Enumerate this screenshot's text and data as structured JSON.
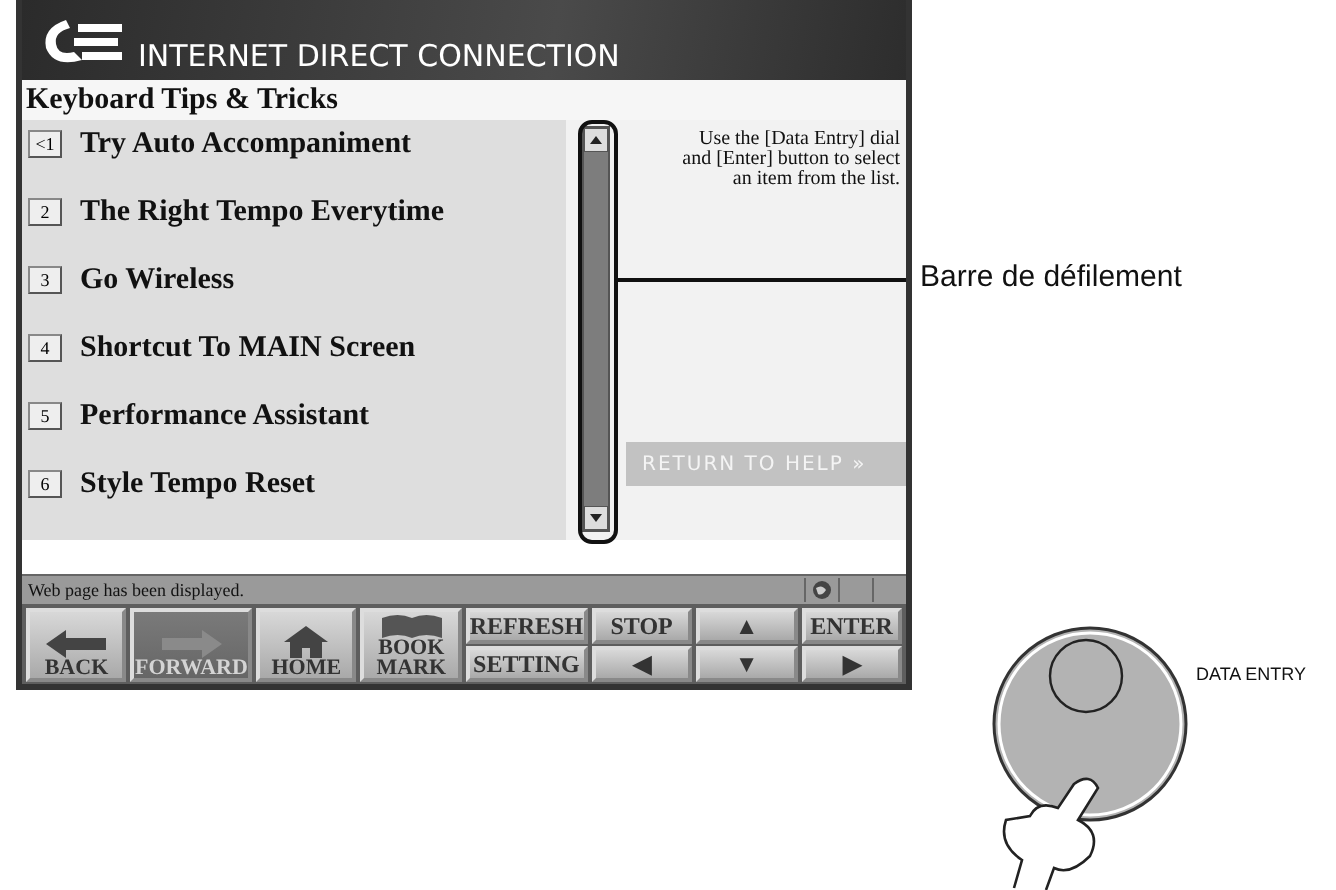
{
  "header": {
    "title": "INTERNET DIRECT CONNECTION"
  },
  "page_title": "Keyboard Tips & Tricks",
  "tips": [
    {
      "number": "<1",
      "label": "Try Auto Accompaniment"
    },
    {
      "number": "2",
      "label": "The Right Tempo Everytime"
    },
    {
      "number": "3",
      "label": "Go Wireless"
    },
    {
      "number": "4",
      "label": "Shortcut To MAIN Screen"
    },
    {
      "number": "5",
      "label": "Performance Assistant"
    },
    {
      "number": "6",
      "label": "Style Tempo Reset"
    }
  ],
  "help_text": [
    "Use the [Data Entry] dial",
    "and [Enter] button to select",
    "an item from the list."
  ],
  "return_button": "RETURN TO HELP »",
  "status_bar": {
    "message": "Web page has been displayed."
  },
  "toolbar": [
    {
      "kind": "back",
      "label": "BACK",
      "disabled": false
    },
    {
      "kind": "forward",
      "label": "FORWARD",
      "disabled": true
    },
    {
      "kind": "home",
      "label": "HOME",
      "disabled": false
    },
    {
      "kind": "book",
      "label": "BOOK MARK",
      "disabled": false
    },
    {
      "kind": "pair",
      "top": "REFRESH",
      "bottom": "SETTING"
    },
    {
      "kind": "pair",
      "top": "STOP",
      "bottom": "◀"
    },
    {
      "kind": "pair",
      "top": "▲",
      "bottom": "▼"
    },
    {
      "kind": "pair",
      "top": "ENTER",
      "bottom": "▶"
    }
  ],
  "callout": {
    "label": "Barre de défilement"
  },
  "dial": {
    "label": "DATA ENTRY"
  }
}
